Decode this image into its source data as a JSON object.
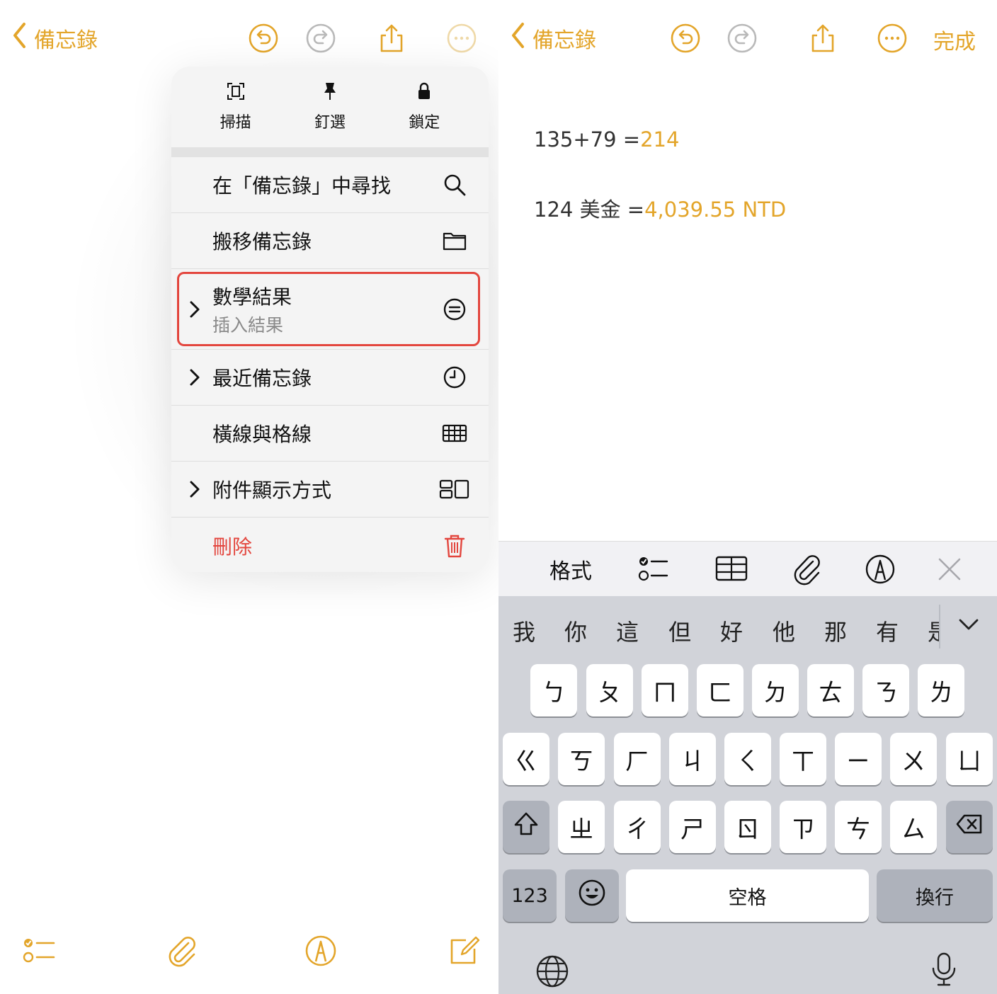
{
  "colors": {
    "accent": "#E3A52A",
    "destructive": "#E3463E",
    "highlight_border": "#E3463E"
  },
  "left": {
    "nav": {
      "back_label": "備忘錄"
    },
    "menu": {
      "top_actions": [
        {
          "label": "掃描",
          "icon": "scan-doc-icon"
        },
        {
          "label": "釘選",
          "icon": "pin-icon"
        },
        {
          "label": "鎖定",
          "icon": "lock-icon"
        }
      ],
      "items": [
        {
          "label": "在「備忘錄」中尋找",
          "icon": "search-icon",
          "submenu": false
        },
        {
          "label": "搬移備忘錄",
          "icon": "folder-icon",
          "submenu": false
        },
        {
          "label": "數學結果",
          "sublabel": "插入結果",
          "icon": "equals-circle-icon",
          "submenu": true,
          "highlighted": true
        },
        {
          "label": "最近備忘錄",
          "icon": "clock-icon",
          "submenu": true
        },
        {
          "label": "橫線與格線",
          "icon": "grid-icon",
          "submenu": false
        },
        {
          "label": "附件顯示方式",
          "icon": "attachment-view-icon",
          "submenu": true
        },
        {
          "label": "刪除",
          "icon": "trash-icon",
          "submenu": false,
          "destructive": true
        }
      ]
    }
  },
  "right": {
    "nav": {
      "back_label": "備忘錄",
      "done_label": "完成"
    },
    "note": {
      "lines": [
        {
          "expr": "135+79 =",
          "result": "214"
        },
        {
          "expr": "124 美金 =",
          "result": "4,039.55 NTD"
        }
      ]
    },
    "format_bar": {
      "format_label": "格式"
    },
    "keyboard": {
      "candidates": [
        "我",
        "你",
        "這",
        "但",
        "好",
        "他",
        "那",
        "有",
        "是"
      ],
      "row1": [
        "ㄅ",
        "ㄆ",
        "ㄇ",
        "ㄈ",
        "ㄉ",
        "ㄊ",
        "ㄋ",
        "ㄌ"
      ],
      "row2": [
        "ㄍ",
        "ㄎ",
        "ㄏ",
        "ㄐ",
        "ㄑ",
        "ㄒ",
        "ㄧ",
        "ㄨ",
        "ㄩ"
      ],
      "row3": [
        "ㄓ",
        "ㄔ",
        "ㄕ",
        "ㄖ",
        "ㄗ",
        "ㄘ",
        "ㄙ"
      ],
      "numbers_label": "123",
      "space_label": "空格",
      "return_label": "換行"
    }
  }
}
